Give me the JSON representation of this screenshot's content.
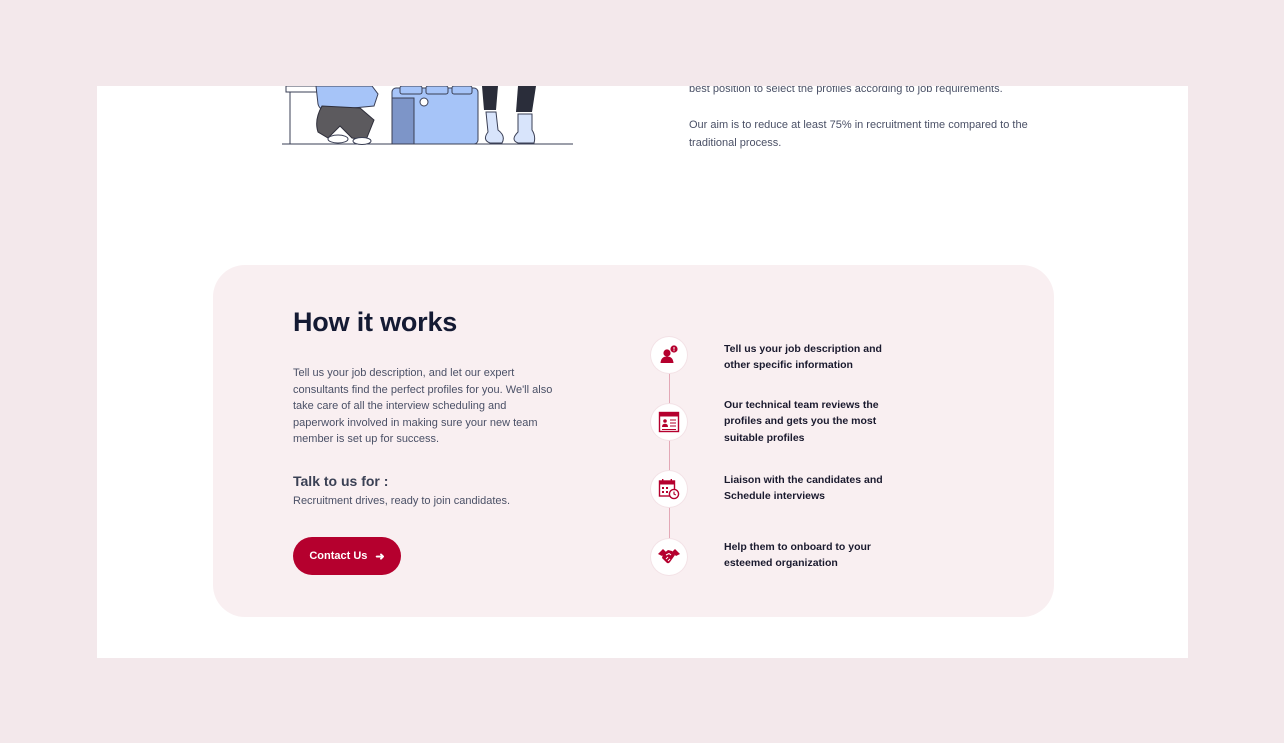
{
  "intro": {
    "paragraph1": "best position to select the profiles according to job requirements.",
    "paragraph2": "Our aim is to reduce at least 75% in recruitment time compared to the traditional process."
  },
  "how_it_works": {
    "title": "How it works",
    "description": "Tell us your job description, and let our expert consultants find the perfect profiles for you.  We'll also take care of all the interview scheduling and paperwork involved in making sure your new team member is set up for success.",
    "talk_title": "Talk to us for :",
    "talk_text": "Recruitment drives, ready to join candidates.",
    "cta_label": "Contact Us",
    "steps": [
      {
        "icon": "person-alert-icon",
        "text": "Tell us your job description and other specific information"
      },
      {
        "icon": "profile-document-icon",
        "text": "Our technical team reviews the profiles and gets you the most suitable profiles"
      },
      {
        "icon": "calendar-clock-icon",
        "text": "Liaison with the candidates and Schedule interviews"
      },
      {
        "icon": "handshake-icon",
        "text": "Help them to onboard to your esteemed organization"
      }
    ]
  },
  "colors": {
    "page_bg": "#f3e8eb",
    "card_bg": "#f9eff1",
    "accent": "#b5002e",
    "heading": "#141a33",
    "body_text": "#4a5066"
  }
}
